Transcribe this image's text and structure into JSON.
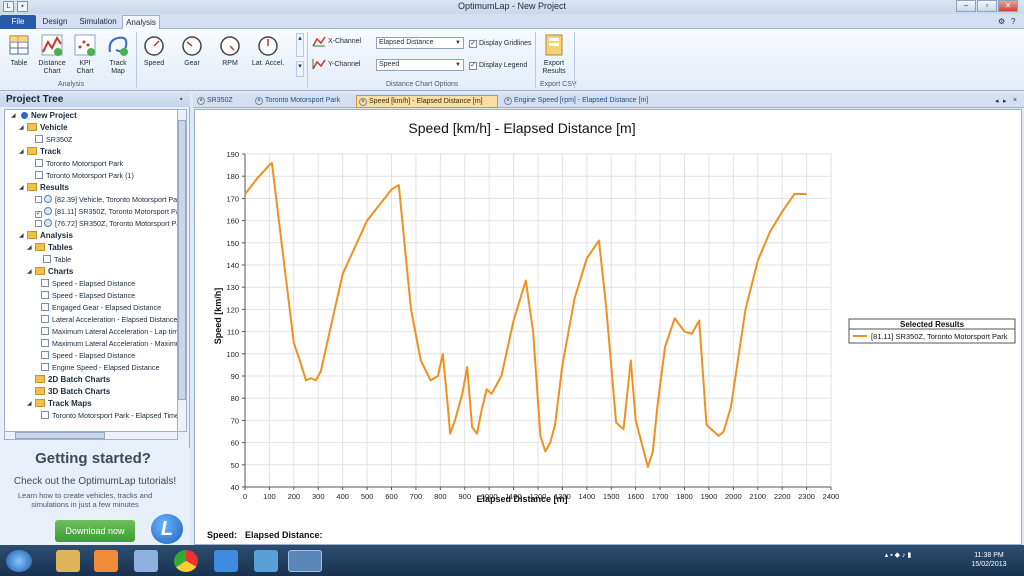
{
  "window": {
    "title": "OptimumLap - New Project"
  },
  "ribbon_tabs": [
    "File",
    "Design",
    "Simulation",
    "Analysis"
  ],
  "ribbon": {
    "analysis_buttons": [
      "Table",
      "Distance Chart",
      "KPI Chart",
      "Track Map"
    ],
    "channel_buttons": [
      "Speed",
      "Gear",
      "RPM",
      "Lat. Accel."
    ],
    "group_analysis": "Analysis",
    "x_channel_label": "X-Channel",
    "y_channel_label": "Y-Channel",
    "x_channel_value": "Elapsed Distance",
    "y_channel_value": "Speed",
    "display_gridlines": "Display Gridlines",
    "display_legend": "Display Legend",
    "group_distance_options": "Distance Chart Options",
    "export_button": "Export Results",
    "group_export": "Export CSV"
  },
  "project_tree": {
    "title": "Project Tree",
    "items": [
      "New Project",
      "Vehicle",
      "SR350Z",
      "Track",
      "Toronto Motorsport Park",
      "Toronto Motorsport Park (1)",
      "Results",
      "[82.39] Vehicle, Toronto Motorsport Pa",
      "[81.11] SR350Z, Toronto Motorsport Pa",
      "[76.72] SR350Z, Toronto Motorsport Pa",
      "Analysis",
      "Tables",
      "Table",
      "Charts",
      "Speed - Elapsed Distance",
      "Speed - Elapsed Distance",
      "Engaged Gear - Elapsed Distance",
      "Lateral Acceleration - Elapsed Distance",
      "Maximum Lateral Acceleration - Lap tim",
      "Maximum Lateral Acceleration - Maximu",
      "Speed - Elapsed Distance",
      "Engine Speed - Elapsed Distance",
      "2D Batch Charts",
      "3D Batch Charts",
      "Track Maps",
      "Toronto Motorsport Park - Elapsed Time"
    ]
  },
  "getting_started": {
    "title": "Getting started?",
    "subtitle": "Check out the OptimumLap tutorials!",
    "text": "Learn how to create vehicles, tracks and simulations in just a few minutes",
    "button": "Download now",
    "logo_letter": "L"
  },
  "doc_tabs": [
    "SR350Z",
    "Toronto Motorsport Park",
    "Speed [km/h] - Elapsed Distance [m]",
    "Engine Speed [rpm] - Elapsed Distance [m]"
  ],
  "status_line": {
    "speed_label": "Speed:",
    "distance_label": "Elapsed Distance:"
  },
  "taskbar": {
    "time": "11:38 PM",
    "date": "15/02/2013"
  },
  "chart_data": {
    "type": "line",
    "title": "Speed [km/h] - Elapsed Distance [m]",
    "xlabel": "Elapsed Distance [m]",
    "ylabel": "Speed [km/h]",
    "xlim": [
      0,
      2400
    ],
    "ylim": [
      40,
      190
    ],
    "x_ticks": [
      0,
      100,
      200,
      300,
      400,
      500,
      600,
      700,
      800,
      900,
      1000,
      1100,
      1200,
      1300,
      1400,
      1500,
      1600,
      1700,
      1800,
      1900,
      2000,
      2100,
      2200,
      2300,
      2400
    ],
    "y_ticks": [
      40,
      50,
      60,
      70,
      80,
      90,
      100,
      110,
      120,
      130,
      140,
      150,
      160,
      170,
      180,
      190
    ],
    "grid": true,
    "legend_title": "Selected Results",
    "legend_position": "right",
    "series": [
      {
        "name": "[81.11] SR350Z, Toronto Motorsport Park",
        "color": "#f0901e",
        "x": [
          0,
          50,
          100,
          110,
          150,
          200,
          230,
          250,
          270,
          290,
          310,
          400,
          500,
          600,
          630,
          680,
          720,
          760,
          790,
          810,
          830,
          840,
          860,
          890,
          910,
          930,
          950,
          970,
          990,
          1010,
          1050,
          1100,
          1150,
          1180,
          1210,
          1230,
          1250,
          1270,
          1300,
          1350,
          1400,
          1450,
          1480,
          1520,
          1550,
          1580,
          1600,
          1650,
          1670,
          1690,
          1720,
          1760,
          1800,
          1830,
          1860,
          1890,
          1920,
          1940,
          1960,
          1990,
          2050,
          2100,
          2150,
          2200,
          2250,
          2300
        ],
        "y": [
          172,
          179,
          185,
          186,
          150,
          105,
          95,
          88,
          89,
          88,
          92,
          136,
          160,
          174,
          176,
          120,
          97,
          88,
          90,
          100,
          77,
          64,
          70,
          82,
          94,
          67,
          64,
          75,
          84,
          82,
          90,
          115,
          133,
          110,
          63,
          56,
          60,
          68,
          95,
          125,
          143,
          151,
          120,
          69,
          66,
          97,
          70,
          49,
          56,
          77,
          103,
          116,
          110,
          109,
          115,
          68,
          65,
          63,
          65,
          76,
          120,
          142,
          155,
          164,
          172,
          172
        ]
      }
    ]
  }
}
